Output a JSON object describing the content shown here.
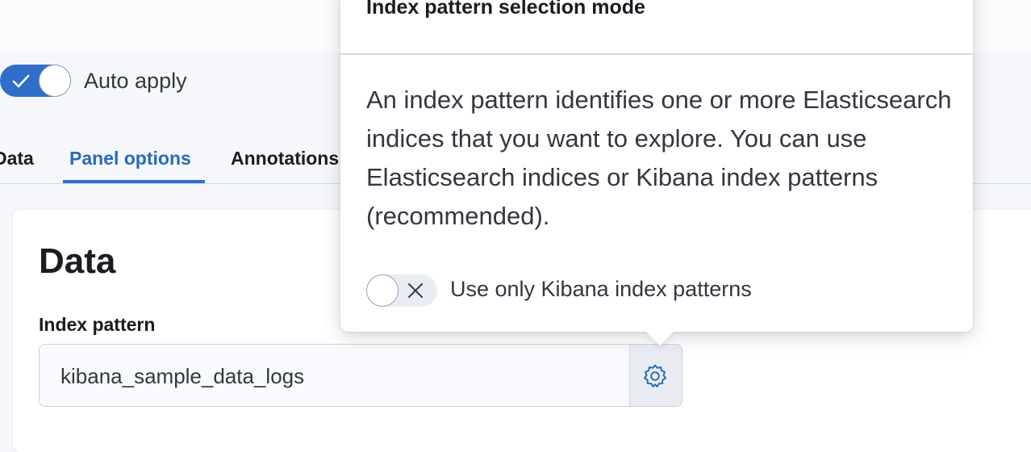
{
  "toolbar": {
    "auto_apply": {
      "label": "Auto apply",
      "checked": true
    }
  },
  "tabs": [
    {
      "label": "Data",
      "active": false
    },
    {
      "label": "Panel options",
      "active": true
    },
    {
      "label": "Annotations",
      "active": false
    }
  ],
  "panel": {
    "title": "Data",
    "index_pattern": {
      "label": "Index pattern",
      "value": "kibana_sample_data_logs",
      "settings_icon": "gear-icon"
    }
  },
  "popover": {
    "title": "Index pattern selection mode",
    "description": "An index pattern identifies one or more Elasticsearch indices that you want to explore. You can use Elasticsearch indices or Kibana index patterns (recommended).",
    "toggle": {
      "label": "Use only Kibana index patterns",
      "checked": false
    }
  },
  "colors": {
    "accent": "#2f6fca",
    "tab_active_text": "#2a6bb6",
    "background": "#f5f7fa"
  }
}
